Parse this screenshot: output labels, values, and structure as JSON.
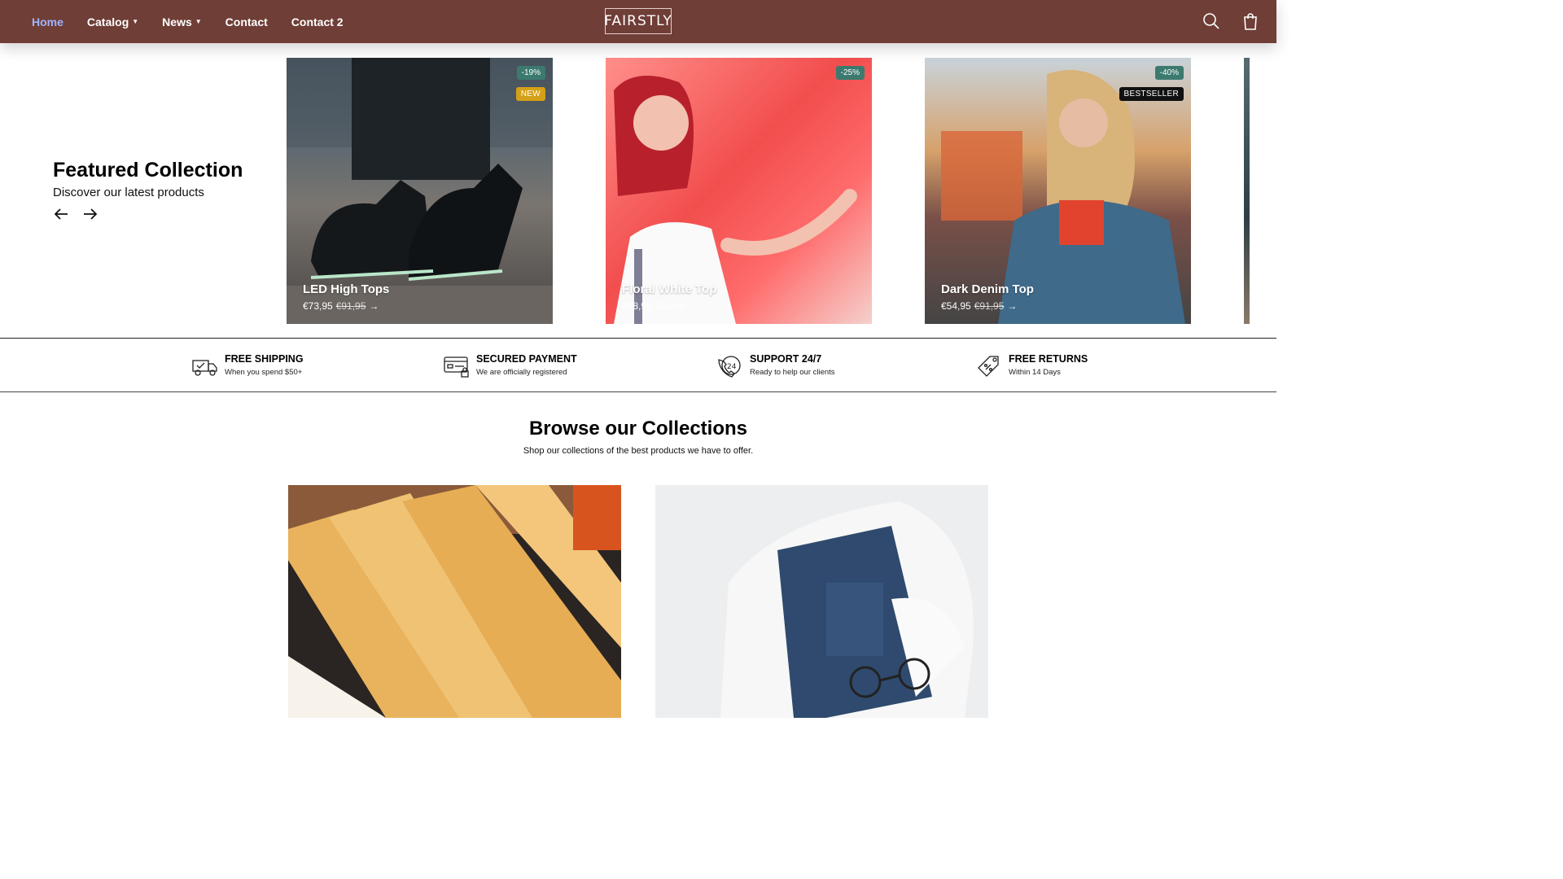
{
  "header": {
    "nav": [
      {
        "label": "Home",
        "active": true,
        "has_dropdown": false
      },
      {
        "label": "Catalog",
        "has_dropdown": true
      },
      {
        "label": "News",
        "has_dropdown": true
      },
      {
        "label": "Contact",
        "has_dropdown": false
      },
      {
        "label": "Contact 2",
        "has_dropdown": false
      }
    ],
    "logo": "FAIRSTLY",
    "icons": [
      "search-icon",
      "shopping-bag-icon"
    ],
    "background_color": "#6f3e37",
    "active_color": "#9fb4ff"
  },
  "featured": {
    "title": "Featured Collection",
    "subtitle": "Discover our latest products",
    "products": [
      {
        "name": "LED High Tops",
        "price": "€73,95",
        "old_price": "€91,95",
        "discount": "-19%",
        "label": "NEW",
        "label_color": "#d4a017"
      },
      {
        "name": "Floral White Top",
        "price": "€68,95",
        "old_price": "€91,95",
        "discount": "-25%",
        "label": ""
      },
      {
        "name": "Dark Denim Top",
        "price": "€54,95",
        "old_price": "€91,95",
        "discount": "-40%",
        "label": "BESTSELLER",
        "label_color": "#111111"
      }
    ],
    "discount_badge_color": "#3c7a6f"
  },
  "usps": [
    {
      "title": "FREE SHIPPING",
      "subtitle": "When you spend $50+",
      "icon": "delivery-truck-icon"
    },
    {
      "title": "SECURED PAYMENT",
      "subtitle": "We are officially registered",
      "icon": "secure-card-icon"
    },
    {
      "title": "SUPPORT 24/7",
      "subtitle": "Ready to help our clients",
      "icon": "support-24-icon"
    },
    {
      "title": "FREE RETURNS",
      "subtitle": "Within 14 Days",
      "icon": "returns-tag-icon"
    }
  ],
  "collections": {
    "title": "Browse our Collections",
    "subtitle": "Shop our collections of the best products we have to offer.",
    "items": [
      {
        "image": "wooden-hangers-image"
      },
      {
        "image": "folded-jeans-sweater-image"
      }
    ]
  }
}
